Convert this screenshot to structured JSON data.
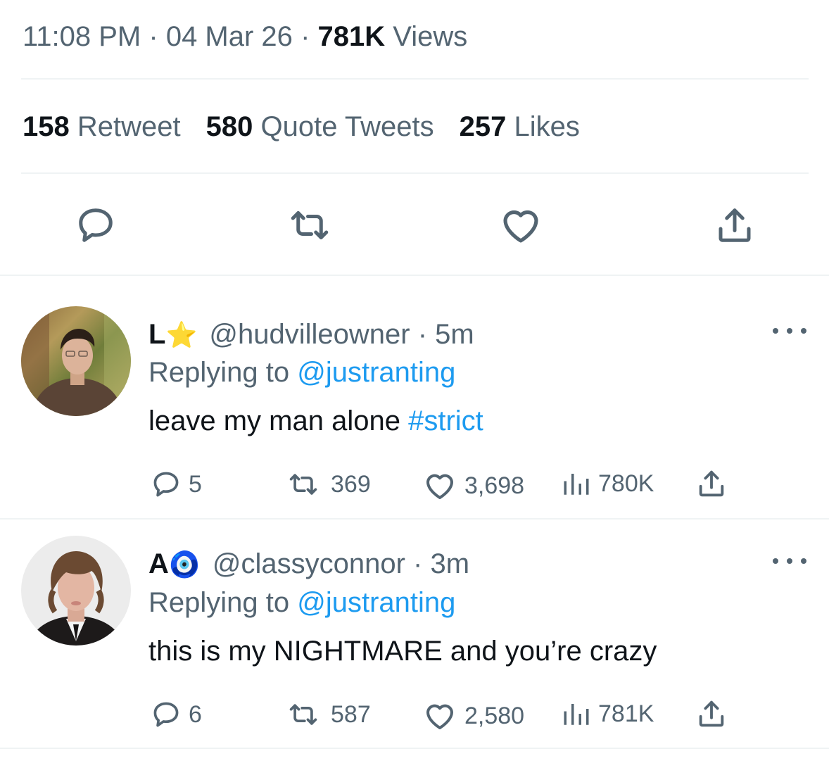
{
  "tweet": {
    "time": "11:08 PM",
    "sep": "·",
    "date": "04 Mar 26",
    "views_count": "781K",
    "views_label": "Views",
    "retweets_count": "158",
    "retweets_label": "Retweet",
    "quotes_count": "580",
    "quotes_label": "Quote Tweets",
    "likes_count": "257",
    "likes_label": "Likes",
    "actions": [
      "reply-icon",
      "retweet-icon",
      "like-icon",
      "share-icon"
    ]
  },
  "replies": [
    {
      "display_name": "L",
      "name_emoji": "⭐",
      "handle": "@hudvilleowner",
      "time": "· 5m",
      "replying_prefix": "Replying to",
      "replying_to": "@justranting",
      "text": "leave my man alone",
      "hashtag": "#strict",
      "reply_count": "5",
      "retweet_count": "369",
      "like_count": "3,698",
      "view_count": "780K"
    },
    {
      "display_name": "A",
      "name_emoji": "🧿",
      "handle": "@classyconnor",
      "time": "· 3m",
      "replying_prefix": "Replying to",
      "replying_to": "@justranting",
      "text": "this is my NIGHTMARE and you’re crazy",
      "reply_count": "6",
      "retweet_count": "587",
      "like_count": "2,580",
      "view_count": "781K"
    }
  ],
  "colors": {
    "link": "#1d9bf0",
    "secondary_text": "#536471",
    "divider": "#eff3f4"
  }
}
